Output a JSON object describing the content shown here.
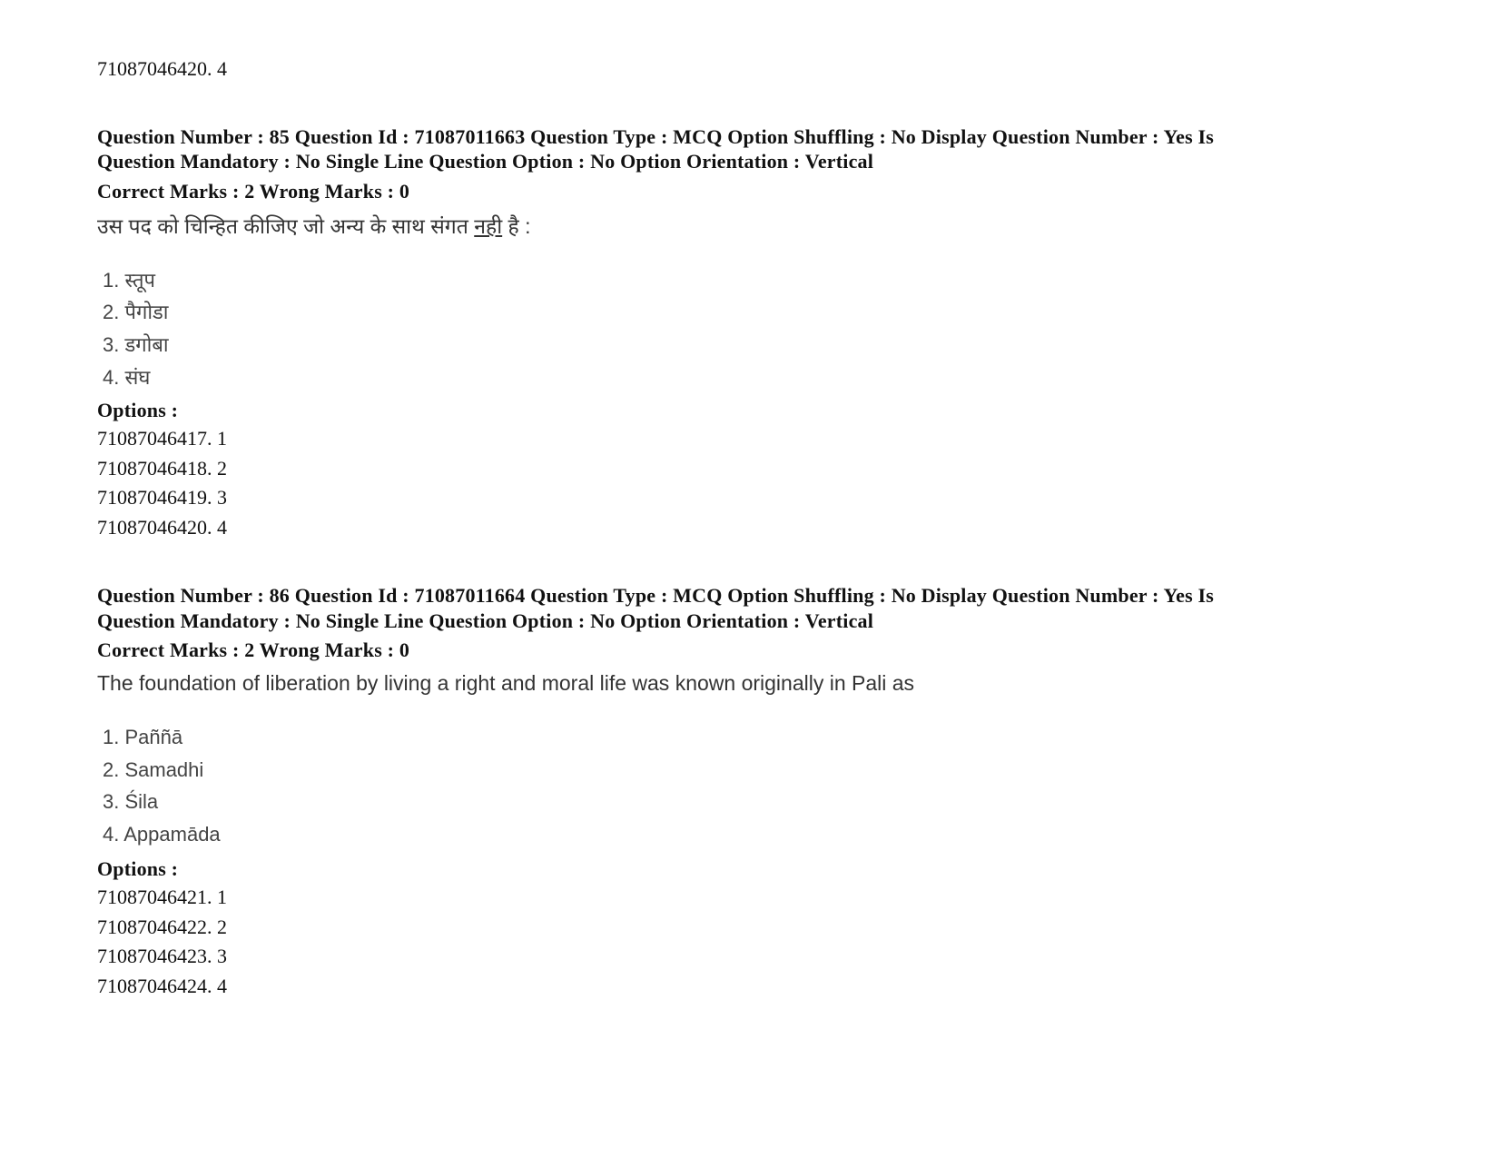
{
  "prev_tail": "71087046420. 4",
  "questions": [
    {
      "meta_line1": "Question Number : 85 Question Id : 71087011663 Question Type : MCQ Option Shuffling : No Display Question Number : Yes Is",
      "meta_line2": "Question Mandatory : No Single Line Question Option : No Option Orientation : Vertical",
      "marks": "Correct Marks : 2 Wrong Marks : 0",
      "text_before": "उस पद को चिन्हित कीजिए जो अन्य के साथ संगत ",
      "text_emph": "नही",
      "text_after": " है :",
      "choices": [
        "1. स्तूप",
        "2. पैगोडा",
        "3. डगोबा",
        "4. संघ"
      ],
      "options_label": "Options :",
      "options": [
        "71087046417. 1",
        "71087046418. 2",
        "71087046419. 3",
        "71087046420. 4"
      ]
    },
    {
      "meta_line1": "Question Number : 86 Question Id : 71087011664 Question Type : MCQ Option Shuffling : No Display Question Number : Yes Is",
      "meta_line2": "Question Mandatory : No Single Line Question Option : No Option Orientation : Vertical",
      "marks": "Correct Marks : 2 Wrong Marks : 0",
      "text": "The foundation of liberation by living a right and moral life was known originally in Pali as",
      "choices": [
        "1. Paññā",
        "2. Samadhi",
        "3. Śila",
        "4. Appamāda"
      ],
      "options_label": "Options :",
      "options": [
        "71087046421. 1",
        "71087046422. 2",
        "71087046423. 3",
        "71087046424. 4"
      ]
    }
  ]
}
